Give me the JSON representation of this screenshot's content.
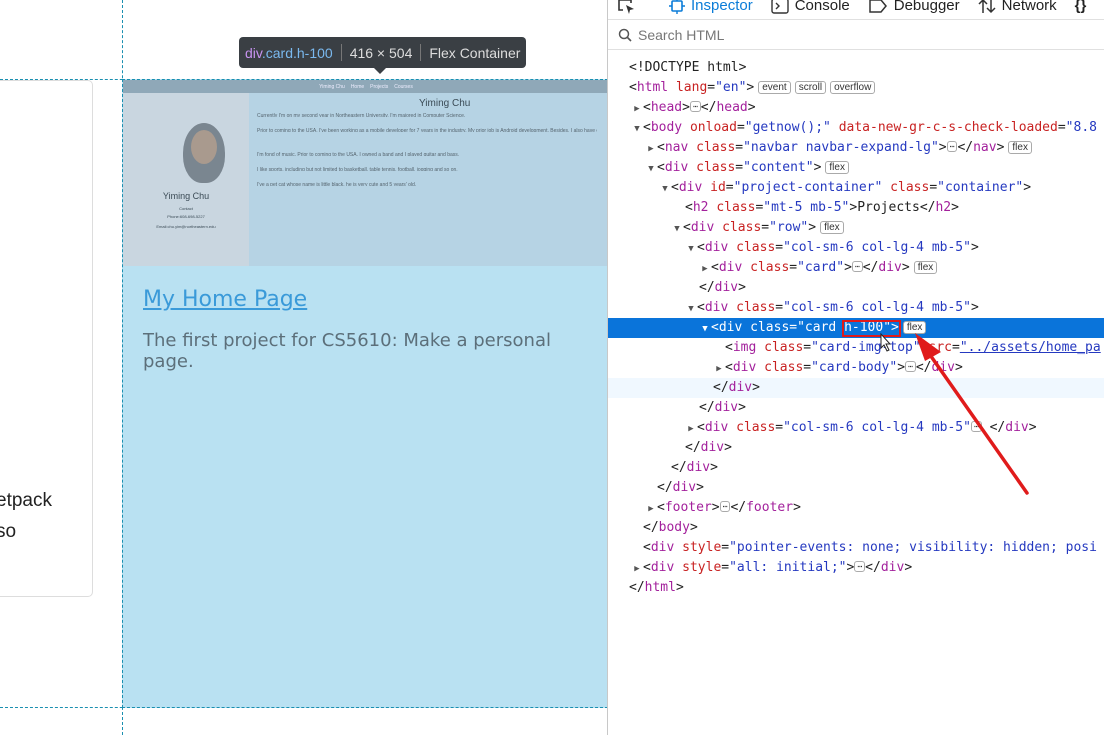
{
  "page": {
    "partial_text_line1": "etpack",
    "partial_text_line2": "so",
    "thumbnail": {
      "nav_items": [
        "Yiming Chu",
        "Home",
        "Projects",
        "Courses"
      ],
      "left_name": "Yiming Chu",
      "left_contact": "Contact",
      "left_phone": "Phone:608-698-5227",
      "left_email": "Email:chu.yim@northeastern.edu",
      "right_title": "Yiming Chu",
      "bullets": [
        "Currently I'm on my second year in Northeastern University. I'm majored in Computer Science.",
        "Prior to coming to the USA, I've been working as a mobile developer for 7 years in the industry. My prior job is Android development. Besides, I also have experience in iOS development and web development.",
        "I'm fond of music. Prior to coming to the USA, I owned a band and I played guitar and bass.",
        "I like sports, including but not limited to basketball, table tennis, football, jogging and so on.",
        "I've a pet cat whose name is little black, he is very cute and 5 years' old."
      ]
    },
    "card_title": "My Home Page",
    "card_text": "The first project for CS5610: Make a personal page."
  },
  "tooltip": {
    "tag": "div",
    "classes": ".card.h-100",
    "size": "416 × 504",
    "type": "Flex Container"
  },
  "devtools": {
    "tabs": [
      {
        "label": "Inspector",
        "icon": "inspector-icon",
        "active": true
      },
      {
        "label": "Console",
        "icon": "console-icon",
        "active": false
      },
      {
        "label": "Debugger",
        "icon": "debugger-icon",
        "active": false
      },
      {
        "label": "Network",
        "icon": "network-icon",
        "active": false
      },
      {
        "label": "{}",
        "icon": "style-editor-icon",
        "active": false
      }
    ],
    "search_placeholder": "Search HTML",
    "tree": {
      "doctype": "<!DOCTYPE html>",
      "html_open": "html",
      "html_attr": "lang",
      "html_val": "\"en\"",
      "badges_html": [
        "event",
        "scroll",
        "overflow"
      ],
      "head": "head",
      "body_attr1": "onload",
      "body_val1": "\"getnow();\"",
      "body_attr2": "data-new-gr-c-s-check-loaded",
      "body_val2": "\"8.8",
      "nav_class": "\"navbar navbar-expand-lg\"",
      "content_class": "\"content\"",
      "proj_id": "\"project-container\"",
      "proj_class": "\"container\"",
      "h2_class": "\"mt-5 mb-5\"",
      "h2_text": "Projects",
      "row_class": "\"row\"",
      "col_class": "\"col-sm-6 col-lg-4 mb-5\"",
      "card_class": "\"card\"",
      "card_h100_class_a": "\"card ",
      "card_h100_class_b": "h-100\"",
      "img_class": "\"card-img-top\"",
      "img_src": "\"../assets/home_pa",
      "cardbody_class": "\"card-body\"",
      "footer": "footer",
      "div_style1": "\"pointer-events: none; visibility: hidden; posi",
      "div_style2": "\"all: initial;\"",
      "flex_badge": "flex",
      "ellipsis": "⋯"
    }
  },
  "colors": {
    "highlight": "#b9e1f2",
    "selection": "#0a74da",
    "annotation": "#e01b1b",
    "accent": "#0a7cd8"
  }
}
